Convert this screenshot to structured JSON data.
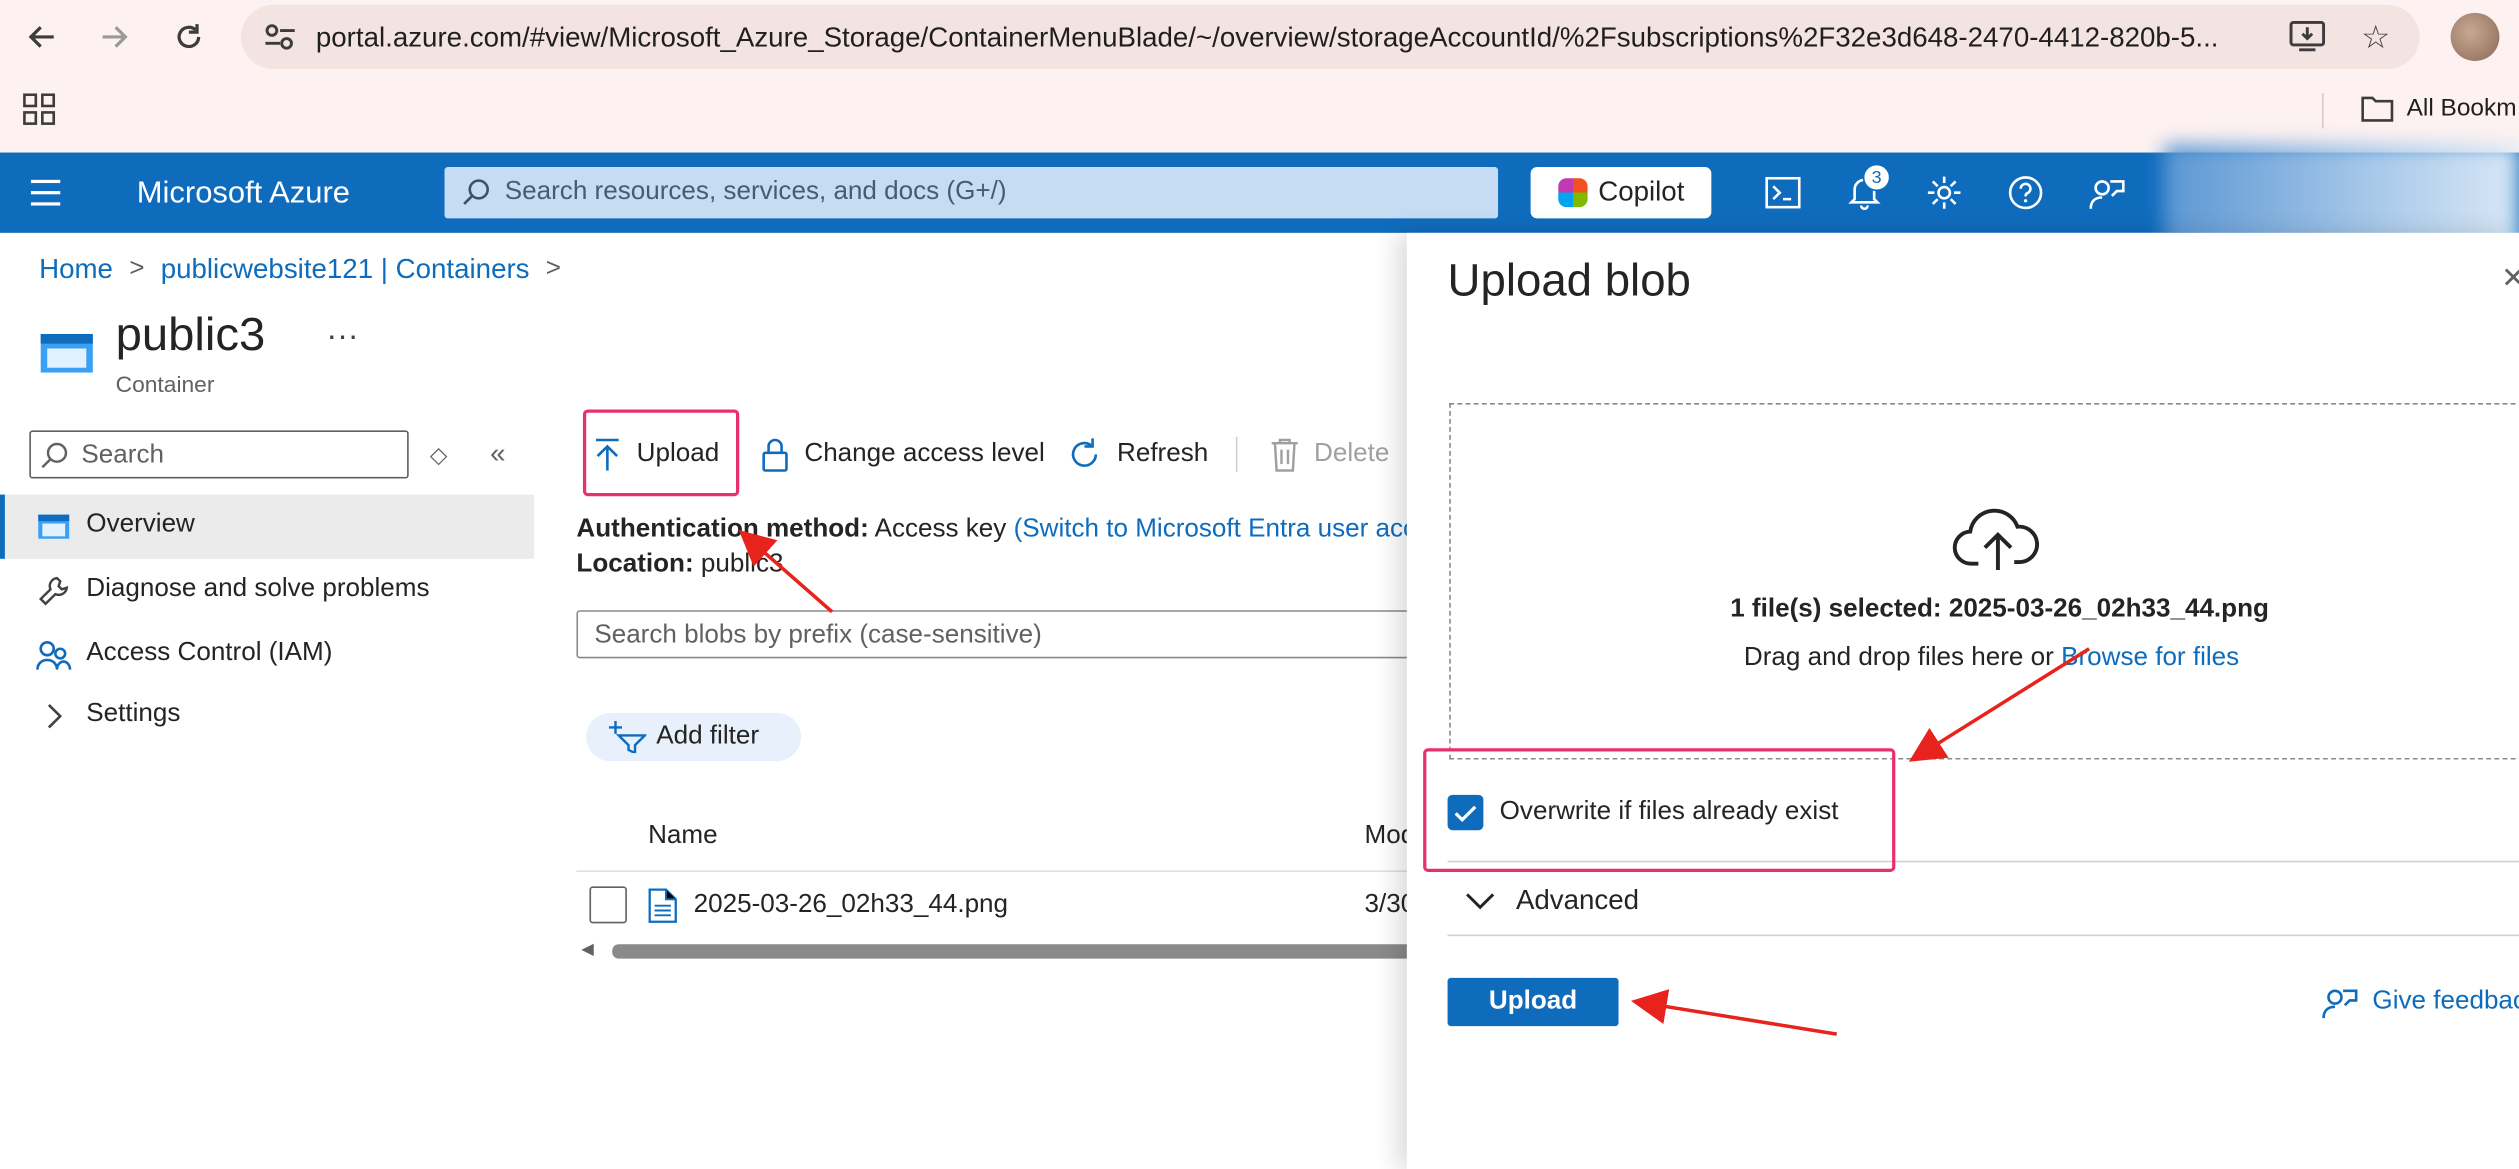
{
  "browser": {
    "url": "portal.azure.com/#view/Microsoft_Azure_Storage/ContainerMenuBlade/~/overview/storageAccountId/%2Fsubscriptions%2F32e3d648-2470-4412-820b-5...",
    "bookmarks_label": "All Bookm",
    "icons": [
      "back-arrow-icon",
      "forward-arrow-icon",
      "reload-icon",
      "site-settings-icon",
      "install-app-icon",
      "star-icon",
      "apps-grid-icon",
      "folder-icon"
    ]
  },
  "azure": {
    "brand": "Microsoft Azure",
    "search_placeholder": "Search resources, services, and docs (G+/)",
    "copilot_label": "Copilot",
    "notification_count": "3",
    "topbar_color": "#0f6cbd"
  },
  "breadcrumb": {
    "items": [
      "Home",
      "publicwebsite121 | Containers"
    ]
  },
  "resource": {
    "title": "public3",
    "subtitle": "Container",
    "more": "..."
  },
  "sidebar": {
    "search_placeholder": "Search",
    "items": [
      {
        "label": "Overview",
        "icon": "container-icon",
        "active": true
      },
      {
        "label": "Diagnose and solve problems",
        "icon": "wrench-icon"
      },
      {
        "label": "Access Control (IAM)",
        "icon": "people-icon"
      },
      {
        "label": "Settings",
        "icon": "chevron-right-icon"
      }
    ]
  },
  "commandbar": {
    "upload": "Upload",
    "change_access": "Change access level",
    "refresh": "Refresh",
    "delete": "Delete"
  },
  "info": {
    "auth_label": "Authentication method:",
    "auth_value": "Access key",
    "auth_link": "(Switch to Microsoft Entra user acc",
    "location_label": "Location:",
    "location_value": "public3"
  },
  "blobs": {
    "search_placeholder": "Search blobs by prefix (case-sensitive)",
    "add_filter": "Add filter",
    "columns": [
      "Name",
      "Mod"
    ],
    "rows": [
      {
        "name": "2025-03-26_02h33_44.png",
        "modified": "3/30"
      }
    ]
  },
  "upload_blade": {
    "title": "Upload blob",
    "selected_text": "1 file(s) selected: 2025-03-26_02h33_44.png",
    "drag_text": "Drag and drop files here",
    "or_text": "or",
    "browse_link": "Browse for files",
    "overwrite_label": "Overwrite if files already exist",
    "overwrite_checked": true,
    "advanced_label": "Advanced",
    "upload_button": "Upload",
    "feedback": "Give feedback"
  },
  "annotation": {
    "highlight_color": "#e8316b",
    "arrow_color": "#e8231d"
  }
}
